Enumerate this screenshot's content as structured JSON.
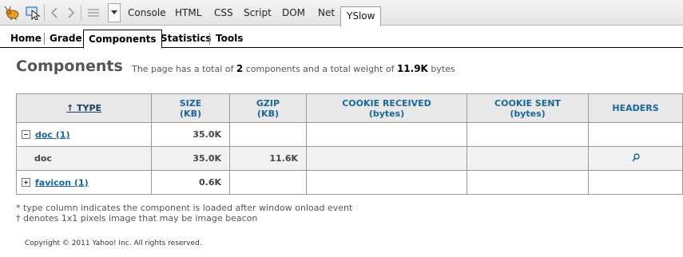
{
  "toolbar": {
    "tabs": [
      "Console",
      "HTML",
      "CSS",
      "Script",
      "DOM",
      "Net"
    ],
    "active_tab": "YSlow"
  },
  "yslow_nav": {
    "tabs": [
      "Home",
      "Grade",
      "Components",
      "Statistics",
      "Tools"
    ],
    "active": "Components"
  },
  "page": {
    "title": "Components",
    "summary_prefix": "The page has a total of",
    "component_count": "2",
    "summary_middle": "components and a total weight of",
    "total_weight": "11.9K",
    "summary_suffix": "bytes"
  },
  "table": {
    "headers": {
      "type": "↑ TYPE",
      "size_line1": "SIZE",
      "size_line2": "(KB)",
      "gzip_line1": "GZIP",
      "gzip_line2": "(KB)",
      "cookie_received_line1": "COOKIE RECEIVED",
      "cookie_received_line2": "(bytes)",
      "cookie_sent_line1": "COOKIE SENT",
      "cookie_sent_line2": "(bytes)",
      "headers": "HEADERS"
    },
    "rows": [
      {
        "kind": "group",
        "expanded": true,
        "label": "doc (1)",
        "size": "35.0K",
        "gzip": "",
        "cookie_received": "",
        "cookie_sent": ""
      },
      {
        "kind": "item",
        "label": "doc",
        "size": "35.0K",
        "gzip": "11.6K",
        "cookie_received": "",
        "cookie_sent": "",
        "headers_icon": "magnifier-icon"
      },
      {
        "kind": "group",
        "expanded": false,
        "label": "favicon (1)",
        "size": "0.6K",
        "gzip": "",
        "cookie_received": "",
        "cookie_sent": ""
      }
    ]
  },
  "notes": [
    "* type column indicates the component is loaded after window onload event",
    "† denotes 1x1 pixels image that may be image beacon"
  ],
  "copyright": "Copyright © 2011 Yahoo! Inc. All rights reserved.",
  "colors": {
    "header_text": "#1a6699",
    "link": "#1a6699",
    "header_bg": "#e8e8e8",
    "child_row_bg": "#f1f1f1"
  }
}
